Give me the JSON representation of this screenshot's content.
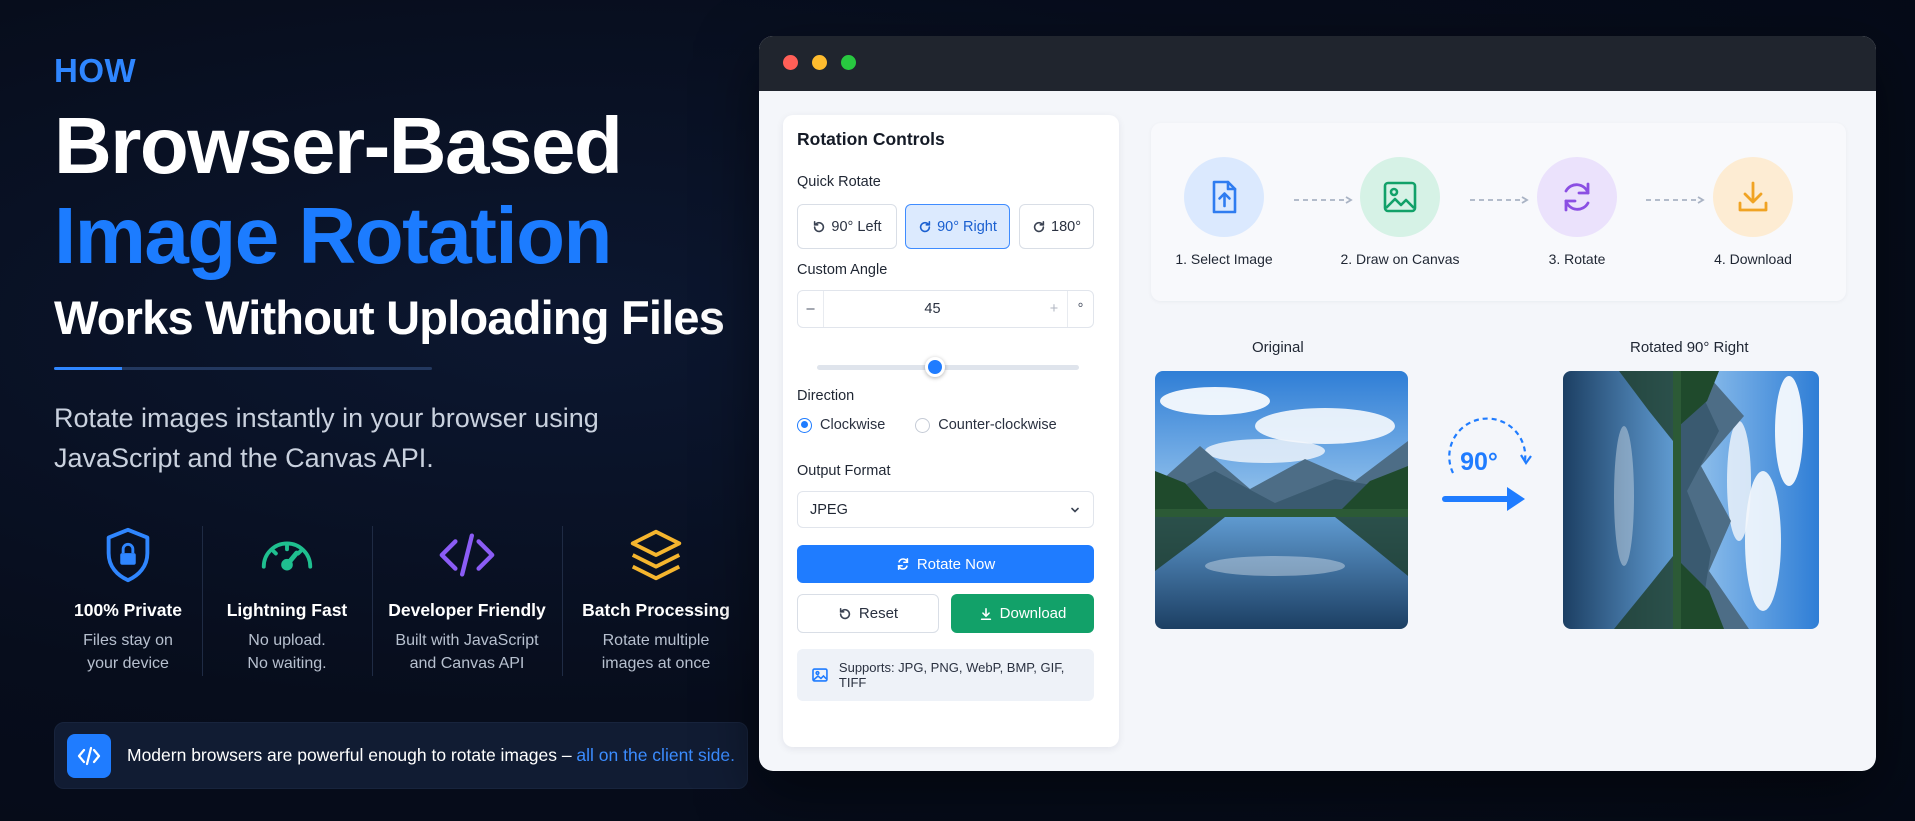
{
  "hero": {
    "eyebrow": "HOW",
    "line1": "Browser-Based",
    "line2": "Image Rotation",
    "line3": "Works Without Uploading Files",
    "subtitle": "Rotate images instantly in your browser using JavaScript and the Canvas API."
  },
  "features": [
    {
      "icon": "shield-lock-icon",
      "title": "100% Private",
      "desc_line1": "Files stay on",
      "desc_line2": "your device",
      "color": "#2f86ff"
    },
    {
      "icon": "speedometer-icon",
      "title": "Lightning Fast",
      "desc_line1": "No upload.",
      "desc_line2": "No waiting.",
      "color": "#1fbf8f"
    },
    {
      "icon": "code-icon",
      "title": "Developer Friendly",
      "desc_line1": "Built with JavaScript",
      "desc_line2": "and Canvas API",
      "color": "#8b5cf6"
    },
    {
      "icon": "layers-icon",
      "title": "Batch Processing",
      "desc_line1": "Rotate multiple",
      "desc_line2": "images at once",
      "color": "#f5b52e"
    }
  ],
  "callout": {
    "text": "Modern browsers are powerful enough to rotate images – ",
    "highlight": "all on the client side."
  },
  "controls": {
    "title": "Rotation Controls",
    "quick_rotate_label": "Quick Rotate",
    "quick_left": "90° Left",
    "quick_right": "90° Right",
    "quick_180": "180°",
    "custom_angle_label": "Custom Angle",
    "minus": "–",
    "angle_value": "45",
    "plus": "+",
    "unit": "°",
    "slider_fraction": 0.45,
    "direction_label": "Direction",
    "clockwise": "Clockwise",
    "counter_clockwise": "Counter-clockwise",
    "output_format_label": "Output Format",
    "output_format": "JPEG",
    "rotate_now": "Rotate Now",
    "reset": "Reset",
    "download": "Download",
    "supports": "Supports: JPG, PNG, WebP, BMP, GIF, TIFF"
  },
  "steps": [
    {
      "label": "1. Select Image",
      "icon": "file-upload-icon"
    },
    {
      "label": "2. Draw on Canvas",
      "icon": "image-icon"
    },
    {
      "label": "3. Rotate",
      "icon": "rotate-icon"
    },
    {
      "label": "4. Download",
      "icon": "download-icon"
    }
  ],
  "preview": {
    "original_label": "Original",
    "rotated_label": "Rotated 90° Right",
    "rotation_text": "90°"
  },
  "colors": {
    "accent": "#1f7cff",
    "success": "#12a169",
    "background": "#070d1c"
  }
}
